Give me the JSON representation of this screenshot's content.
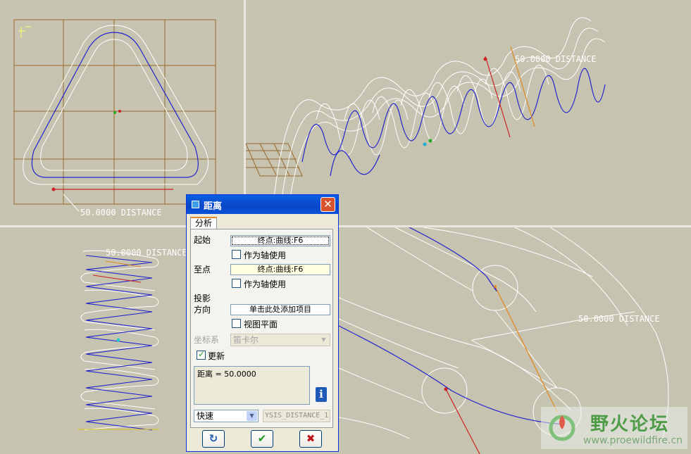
{
  "viewports": {
    "top_left": {
      "dimension": "50.0000  DISTANCE"
    },
    "top_right": {
      "dimension": "50.0000  DISTANCE"
    },
    "bottom_left": {
      "dimension": "50.0000  DISTANCE"
    },
    "bottom_right": {
      "dimension": "50.0000  DISTANCE"
    }
  },
  "dialog": {
    "title": "距离",
    "close_glyph": "✕",
    "tab": "分析",
    "start_label": "起始",
    "start_value": "终点:曲线:F6",
    "start_axis_label": "作为轴使用",
    "to_label": "至点",
    "to_value": "终点:曲线:F6",
    "to_axis_label": "作为轴使用",
    "projection_label_1": "投影",
    "projection_label_2": "方向",
    "projection_value": "单击此处添加项目",
    "view_plane_label": "视图平面",
    "coord_label": "坐标系",
    "coord_value": "笛卡尔",
    "update_label": "更新",
    "update_checked": true,
    "result": "距离 = 50.0000",
    "info_glyph": "i",
    "mode_value": "快速",
    "feature_name": "YSIS_DISTANCE_1",
    "buttons": {
      "refresh": "↻",
      "ok": "✔",
      "cancel": "✖"
    },
    "colors": {
      "title_bar": "#0847c8",
      "ok": "#1a9a1a",
      "cancel": "#c0141c"
    }
  },
  "watermark": {
    "title": "野火论坛",
    "url": "www.proewildfire.cn"
  }
}
